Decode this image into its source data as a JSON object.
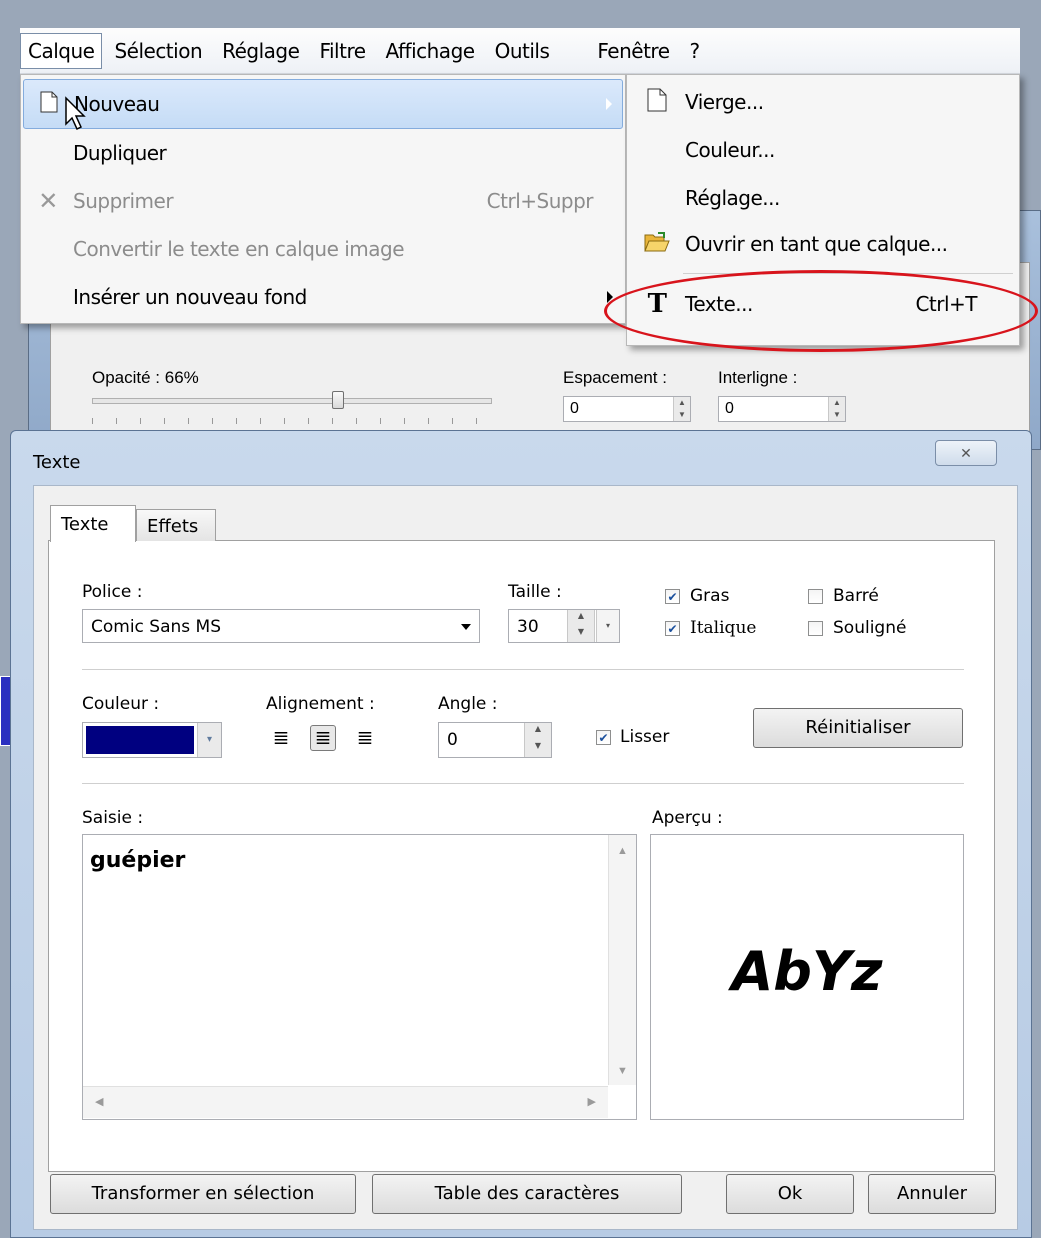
{
  "menubar": {
    "items": [
      "Calque",
      "Sélection",
      "Réglage",
      "Filtre",
      "Affichage",
      "Outils",
      "Fenêtre",
      "?"
    ]
  },
  "dropdown": {
    "items": [
      {
        "label": "Nouveau",
        "icon": "blank-page-icon",
        "submenu": true,
        "highlighted": true
      },
      {
        "label": "Dupliquer"
      },
      {
        "label": "Supprimer",
        "icon": "delete-x-icon",
        "shortcut": "Ctrl+Suppr",
        "disabled": true
      },
      {
        "label": "Convertir le texte en calque image",
        "disabled": true
      },
      {
        "label": "Insérer un nouveau fond",
        "submenu": true
      }
    ]
  },
  "submenu": {
    "items": [
      {
        "label": "Vierge...",
        "icon": "blank-page-icon"
      },
      {
        "label": "Couleur..."
      },
      {
        "label": "Réglage..."
      },
      {
        "label": "Ouvrir en tant que calque...",
        "icon": "open-folder-icon"
      },
      {
        "label": "Texte...",
        "icon": "text-t-icon",
        "shortcut": "Ctrl+T"
      }
    ]
  },
  "background_panel": {
    "opacity_label": "Opacité : 66%",
    "opacity_value": 0.66,
    "spacing_label": "Espacement :",
    "spacing_value": "0",
    "line_label": "Interligne :",
    "line_value": "0"
  },
  "dialog": {
    "title": "Texte",
    "close_glyph": "✕",
    "tabs": [
      "Texte",
      "Effets"
    ],
    "font_label": "Police :",
    "font_value": "Comic Sans MS",
    "size_label": "Taille :",
    "size_value": "30",
    "bold_label": "Gras",
    "bold_checked": true,
    "italic_label": "Italique",
    "italic_checked": true,
    "strike_label": "Barré",
    "strike_checked": false,
    "underline_label": "Souligné",
    "underline_checked": false,
    "color_label": "Couleur :",
    "color_value": "#000080",
    "align_label": "Alignement :",
    "align_options": [
      "align-left-icon",
      "align-center-icon",
      "align-right-icon"
    ],
    "align_selected": "center",
    "angle_label": "Angle :",
    "angle_value": "0",
    "smooth_label": "Lisser",
    "smooth_checked": true,
    "reset_button": "Réinitialiser",
    "input_label": "Saisie :",
    "input_value": "guépier",
    "preview_label": "Aperçu :",
    "preview_text": "AbYz",
    "buttons": {
      "to_selection": "Transformer en sélection",
      "char_table": "Table des caractères",
      "ok": "Ok",
      "cancel": "Annuler"
    }
  },
  "colors": {
    "highlight_ellipse": "#d8141c",
    "text_color_swatch": "#000080"
  }
}
